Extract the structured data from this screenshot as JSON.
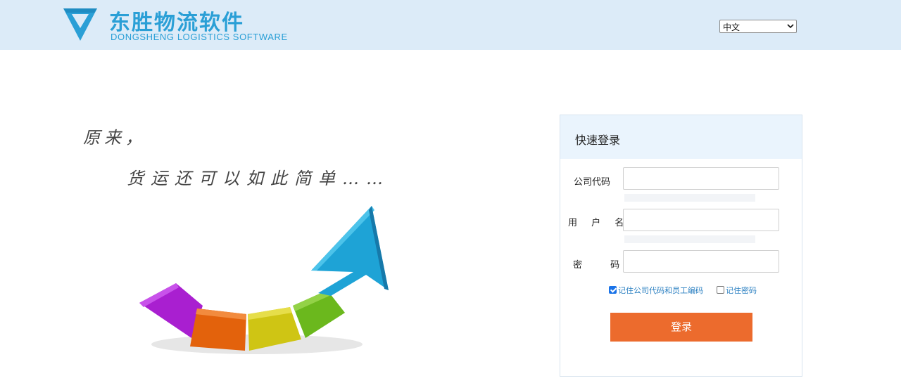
{
  "header": {
    "logo_icon": "diamond-logo-icon",
    "title": "东胜物流软件",
    "subtitle": "DONGSHENG LOGISTICS SOFTWARE",
    "language_select": {
      "value": "中文",
      "icon": "chevron-down-icon"
    }
  },
  "hero": {
    "line1": "原来，",
    "line2": "货运还可以如此简单……"
  },
  "login": {
    "title": "快速登录",
    "fields": [
      {
        "label": "公司代码",
        "value": ""
      },
      {
        "label": "用 户 名",
        "value": ""
      },
      {
        "label": "密 码",
        "value": ""
      }
    ],
    "remember_company": {
      "label": "记住公司代码和员工编码",
      "checked": true
    },
    "remember_password": {
      "label": "记住密码",
      "checked": false
    },
    "submit_label": "登录"
  },
  "colors": {
    "header_bg": "#dcebf8",
    "brand": "#2a9fd6",
    "button": "#ec6b2d",
    "panel_head": "#eaf4fd"
  }
}
